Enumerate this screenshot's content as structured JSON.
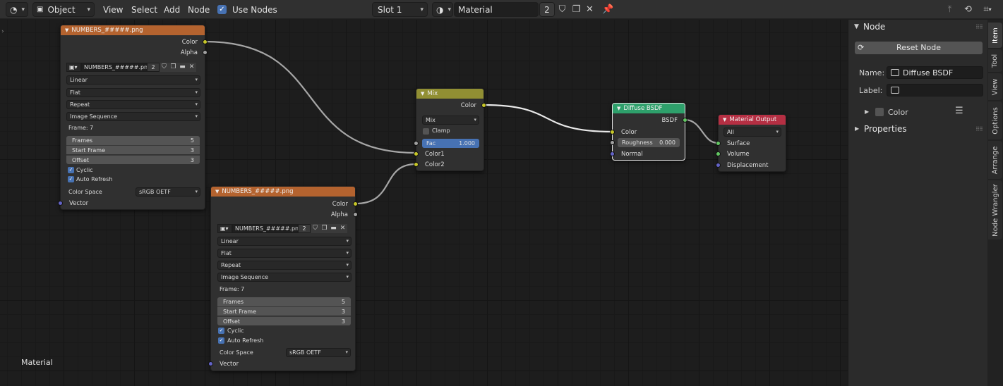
{
  "header": {
    "editor_type_icon": "node-editor-icon",
    "mode": "Object",
    "menus": [
      "View",
      "Select",
      "Add",
      "Node"
    ],
    "use_nodes_label": "Use Nodes",
    "use_nodes_checked": true,
    "slot": "Slot 1",
    "material_name": "Material",
    "material_users": "2"
  },
  "editor": {
    "material_label": "Material",
    "nodes": {
      "image1": {
        "title": "NUMBERS_#####.png",
        "out_color": "Color",
        "out_alpha": "Alpha",
        "image_name": "NUMBERS_#####.png",
        "image_users": "2",
        "interpolation": "Linear",
        "projection": "Flat",
        "extension": "Repeat",
        "source": "Image Sequence",
        "frame_text": "Frame: 7",
        "frames_label": "Frames",
        "frames_value": "5",
        "start_label": "Start Frame",
        "start_value": "3",
        "offset_label": "Offset",
        "offset_value": "3",
        "cyclic_label": "Cyclic",
        "auto_refresh_label": "Auto Refresh",
        "color_space_label": "Color Space",
        "color_space_value": "sRGB OETF",
        "vector_label": "Vector"
      },
      "image2": {
        "title": "NUMBERS_#####.png",
        "out_color": "Color",
        "out_alpha": "Alpha",
        "image_name": "NUMBERS_#####.png",
        "image_users": "2",
        "interpolation": "Linear",
        "projection": "Flat",
        "extension": "Repeat",
        "source": "Image Sequence",
        "frame_text": "Frame: 7",
        "frames_label": "Frames",
        "frames_value": "5",
        "start_label": "Start Frame",
        "start_value": "3",
        "offset_label": "Offset",
        "offset_value": "3",
        "cyclic_label": "Cyclic",
        "auto_refresh_label": "Auto Refresh",
        "color_space_label": "Color Space",
        "color_space_value": "sRGB OETF",
        "vector_label": "Vector"
      },
      "mix": {
        "title": "Mix",
        "out_color": "Color",
        "blend": "Mix",
        "clamp_label": "Clamp",
        "fac_label": "Fac",
        "fac_value": "1.000",
        "color1": "Color1",
        "color2": "Color2"
      },
      "diffuse": {
        "title": "Diffuse BSDF",
        "out_bsdf": "BSDF",
        "in_color": "Color",
        "roughness_label": "Roughness",
        "roughness_value": "0.000",
        "in_normal": "Normal"
      },
      "output": {
        "title": "Material Output",
        "target": "All",
        "surface": "Surface",
        "volume": "Volume",
        "displacement": "Displacement"
      }
    },
    "colors": {
      "image_header": "#b4632f",
      "mix_header": "#918f33",
      "shader_header": "#2ea06b",
      "output_header": "#b52f43",
      "link": "#a6a6a6"
    }
  },
  "sidebar": {
    "panel_title": "Node",
    "reset_label": "Reset Node",
    "name_label": "Name:",
    "name_value": "Diffuse BSDF",
    "label_label": "Label:",
    "label_value": "",
    "color_label": "Color",
    "properties_label": "Properties",
    "tabs": [
      "Item",
      "Tool",
      "View",
      "Options",
      "Arrange",
      "Node Wrangler"
    ]
  }
}
